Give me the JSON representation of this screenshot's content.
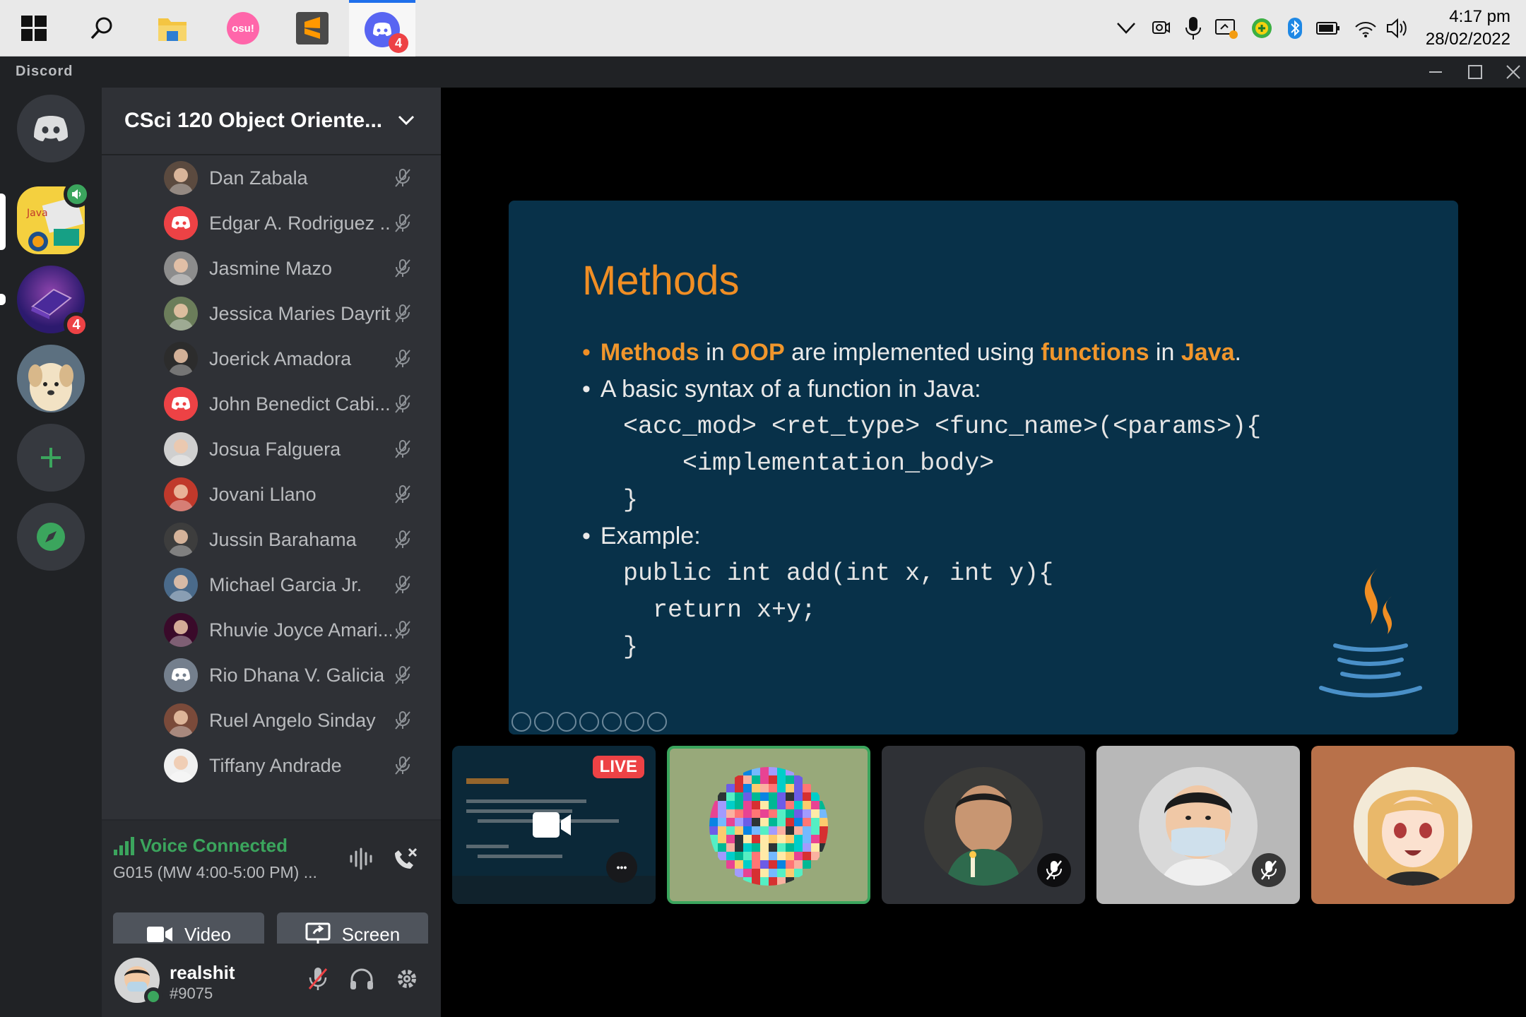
{
  "taskbar": {
    "apps": [
      "start",
      "search",
      "file-explorer",
      "osu",
      "sublime-text",
      "discord"
    ],
    "osu_label": "osu!",
    "discord_badge": "4",
    "tray_icons": [
      "chevron-up",
      "camera",
      "microphone",
      "screen-capture",
      "vpn",
      "bluetooth",
      "battery",
      "wifi",
      "volume"
    ],
    "time": "4:17 pm",
    "date": "28/02/2022"
  },
  "window": {
    "title": "Discord"
  },
  "servers": [
    {
      "name": "discord-home"
    },
    {
      "name": "java-server",
      "speaking": true
    },
    {
      "name": "laptop-server",
      "badge": "4"
    },
    {
      "name": "puppy-server"
    },
    {
      "name": "add-server"
    },
    {
      "name": "explore-servers"
    }
  ],
  "sidebar": {
    "server_name": "CSci 120 Object Oriente...",
    "members": [
      {
        "name": "Dan Zabala"
      },
      {
        "name": "Edgar A. Rodriguez ..."
      },
      {
        "name": "Jasmine Mazo"
      },
      {
        "name": "Jessica Maries Dayrit"
      },
      {
        "name": "Joerick Amadora"
      },
      {
        "name": "John Benedict Cabi..."
      },
      {
        "name": "Josua Falguera"
      },
      {
        "name": "Jovani Llano"
      },
      {
        "name": "Jussin Barahama"
      },
      {
        "name": "Michael Garcia Jr."
      },
      {
        "name": "Rhuvie Joyce Amari..."
      },
      {
        "name": "Rio Dhana V. Galicia"
      },
      {
        "name": "Ruel Angelo Sinday"
      },
      {
        "name": "Tiffany Andrade"
      }
    ],
    "voice": {
      "status": "Voice Connected",
      "channel": "G015 (MW 4:00-5:00 PM) ...",
      "video_label": "Video",
      "screen_label": "Screen"
    },
    "user": {
      "name": "realshit",
      "tag": "#9075"
    }
  },
  "slide": {
    "title": "Methods",
    "b1": {
      "w1": "Methods",
      "t1": " in ",
      "w2": "OOP",
      "t2": " are implemented using ",
      "w3": "functions",
      "t3": " in ",
      "w4": "Java",
      "t4": "."
    },
    "b2": "A basic syntax of a function in Java:",
    "code1": [
      "<acc_mod> <ret_type> <func_name>(<params>){",
      "    <implementation_body>",
      "}"
    ],
    "b3": "Example:",
    "code2": [
      "public int add(int x, int y){",
      "  return x+y;",
      "}"
    ]
  },
  "tiles": {
    "live_label": "LIVE",
    "more_label": "•••"
  },
  "colors": {
    "accent_orange": "#f08e24",
    "voice_green": "#3ba55d",
    "discord_blurple": "#5865f2",
    "danger_red": "#ed4245"
  }
}
